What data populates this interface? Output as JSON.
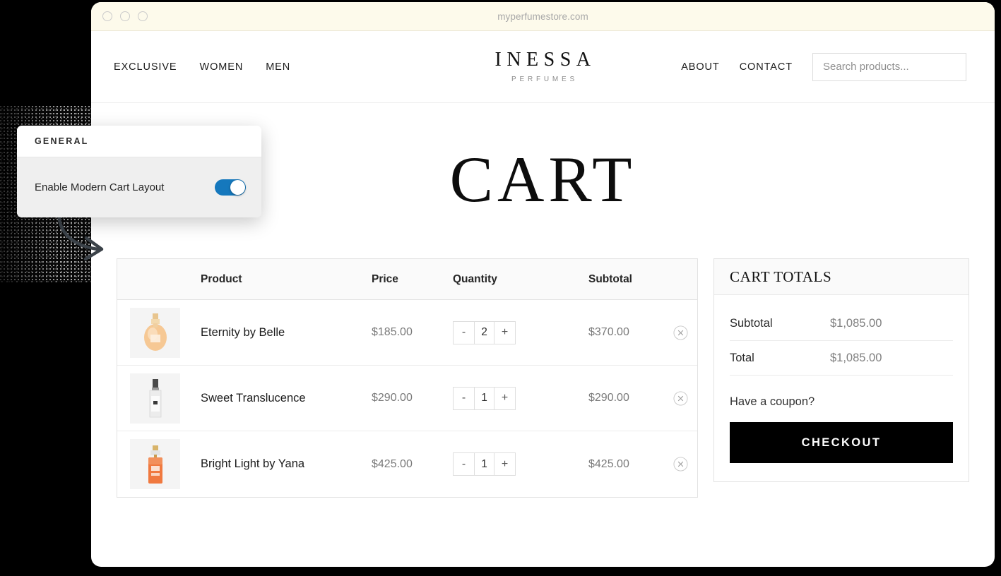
{
  "browser": {
    "url": "myperfumestore.com",
    "window_dots": [
      "close",
      "minimize",
      "maximize"
    ]
  },
  "settings_overlay": {
    "section_title": "GENERAL",
    "option_label": "Enable Modern Cart Layout",
    "toggle_state": "on",
    "toggle_color": "#1578bd"
  },
  "site": {
    "nav_left": [
      {
        "label": "EXCLUSIVE"
      },
      {
        "label": "WOMEN"
      },
      {
        "label": "MEN"
      }
    ],
    "logo": {
      "name": "INESSA",
      "tagline": "PERFUMES"
    },
    "nav_right": [
      {
        "label": "ABOUT"
      },
      {
        "label": "CONTACT"
      }
    ],
    "search": {
      "placeholder": "Search products...",
      "value": ""
    }
  },
  "page": {
    "title": "CART"
  },
  "cart": {
    "columns": [
      "",
      "Product",
      "Price",
      "Quantity",
      "Subtotal",
      ""
    ],
    "headers": {
      "product": "Product",
      "price": "Price",
      "quantity": "Quantity",
      "subtotal": "Subtotal"
    },
    "items": [
      {
        "name": "Eternity by Belle",
        "price": "$185.00",
        "quantity": "2",
        "subtotal": "$370.00",
        "decrement": "-",
        "increment": "+",
        "thumb_kind": "round-peach-bottle"
      },
      {
        "name": "Sweet Translucence",
        "price": "$290.00",
        "quantity": "1",
        "subtotal": "$290.00",
        "decrement": "-",
        "increment": "+",
        "thumb_kind": "tall-white-bottle"
      },
      {
        "name": "Bright Light by Yana",
        "price": "$425.00",
        "quantity": "1",
        "subtotal": "$425.00",
        "decrement": "-",
        "increment": "+",
        "thumb_kind": "orange-rect-bottle"
      }
    ]
  },
  "totals": {
    "title": "CART TOTALS",
    "rows": [
      {
        "label": "Subtotal",
        "value": "$1,085.00"
      },
      {
        "label": "Total",
        "value": "$1,085.00"
      }
    ],
    "coupon_link": "Have a coupon?",
    "checkout_label": "CHECKOUT",
    "checkout_bg": "#000000"
  }
}
